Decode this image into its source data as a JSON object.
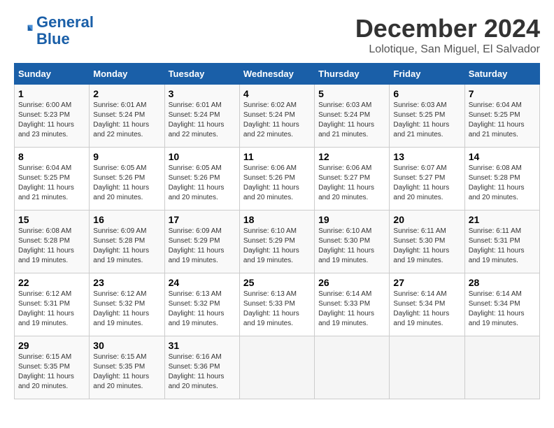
{
  "header": {
    "logo_line1": "General",
    "logo_line2": "Blue",
    "month_year": "December 2024",
    "location": "Lolotique, San Miguel, El Salvador"
  },
  "weekdays": [
    "Sunday",
    "Monday",
    "Tuesday",
    "Wednesday",
    "Thursday",
    "Friday",
    "Saturday"
  ],
  "weeks": [
    [
      {
        "day": 1,
        "sunrise": "6:00 AM",
        "sunset": "5:23 PM",
        "daylight": "11 hours and 23 minutes."
      },
      {
        "day": 2,
        "sunrise": "6:01 AM",
        "sunset": "5:24 PM",
        "daylight": "11 hours and 22 minutes."
      },
      {
        "day": 3,
        "sunrise": "6:01 AM",
        "sunset": "5:24 PM",
        "daylight": "11 hours and 22 minutes."
      },
      {
        "day": 4,
        "sunrise": "6:02 AM",
        "sunset": "5:24 PM",
        "daylight": "11 hours and 22 minutes."
      },
      {
        "day": 5,
        "sunrise": "6:03 AM",
        "sunset": "5:24 PM",
        "daylight": "11 hours and 21 minutes."
      },
      {
        "day": 6,
        "sunrise": "6:03 AM",
        "sunset": "5:25 PM",
        "daylight": "11 hours and 21 minutes."
      },
      {
        "day": 7,
        "sunrise": "6:04 AM",
        "sunset": "5:25 PM",
        "daylight": "11 hours and 21 minutes."
      }
    ],
    [
      {
        "day": 8,
        "sunrise": "6:04 AM",
        "sunset": "5:25 PM",
        "daylight": "11 hours and 21 minutes."
      },
      {
        "day": 9,
        "sunrise": "6:05 AM",
        "sunset": "5:26 PM",
        "daylight": "11 hours and 20 minutes."
      },
      {
        "day": 10,
        "sunrise": "6:05 AM",
        "sunset": "5:26 PM",
        "daylight": "11 hours and 20 minutes."
      },
      {
        "day": 11,
        "sunrise": "6:06 AM",
        "sunset": "5:26 PM",
        "daylight": "11 hours and 20 minutes."
      },
      {
        "day": 12,
        "sunrise": "6:06 AM",
        "sunset": "5:27 PM",
        "daylight": "11 hours and 20 minutes."
      },
      {
        "day": 13,
        "sunrise": "6:07 AM",
        "sunset": "5:27 PM",
        "daylight": "11 hours and 20 minutes."
      },
      {
        "day": 14,
        "sunrise": "6:08 AM",
        "sunset": "5:28 PM",
        "daylight": "11 hours and 20 minutes."
      }
    ],
    [
      {
        "day": 15,
        "sunrise": "6:08 AM",
        "sunset": "5:28 PM",
        "daylight": "11 hours and 19 minutes."
      },
      {
        "day": 16,
        "sunrise": "6:09 AM",
        "sunset": "5:28 PM",
        "daylight": "11 hours and 19 minutes."
      },
      {
        "day": 17,
        "sunrise": "6:09 AM",
        "sunset": "5:29 PM",
        "daylight": "11 hours and 19 minutes."
      },
      {
        "day": 18,
        "sunrise": "6:10 AM",
        "sunset": "5:29 PM",
        "daylight": "11 hours and 19 minutes."
      },
      {
        "day": 19,
        "sunrise": "6:10 AM",
        "sunset": "5:30 PM",
        "daylight": "11 hours and 19 minutes."
      },
      {
        "day": 20,
        "sunrise": "6:11 AM",
        "sunset": "5:30 PM",
        "daylight": "11 hours and 19 minutes."
      },
      {
        "day": 21,
        "sunrise": "6:11 AM",
        "sunset": "5:31 PM",
        "daylight": "11 hours and 19 minutes."
      }
    ],
    [
      {
        "day": 22,
        "sunrise": "6:12 AM",
        "sunset": "5:31 PM",
        "daylight": "11 hours and 19 minutes."
      },
      {
        "day": 23,
        "sunrise": "6:12 AM",
        "sunset": "5:32 PM",
        "daylight": "11 hours and 19 minutes."
      },
      {
        "day": 24,
        "sunrise": "6:13 AM",
        "sunset": "5:32 PM",
        "daylight": "11 hours and 19 minutes."
      },
      {
        "day": 25,
        "sunrise": "6:13 AM",
        "sunset": "5:33 PM",
        "daylight": "11 hours and 19 minutes."
      },
      {
        "day": 26,
        "sunrise": "6:14 AM",
        "sunset": "5:33 PM",
        "daylight": "11 hours and 19 minutes."
      },
      {
        "day": 27,
        "sunrise": "6:14 AM",
        "sunset": "5:34 PM",
        "daylight": "11 hours and 19 minutes."
      },
      {
        "day": 28,
        "sunrise": "6:14 AM",
        "sunset": "5:34 PM",
        "daylight": "11 hours and 19 minutes."
      }
    ],
    [
      {
        "day": 29,
        "sunrise": "6:15 AM",
        "sunset": "5:35 PM",
        "daylight": "11 hours and 20 minutes."
      },
      {
        "day": 30,
        "sunrise": "6:15 AM",
        "sunset": "5:35 PM",
        "daylight": "11 hours and 20 minutes."
      },
      {
        "day": 31,
        "sunrise": "6:16 AM",
        "sunset": "5:36 PM",
        "daylight": "11 hours and 20 minutes."
      },
      null,
      null,
      null,
      null
    ]
  ]
}
